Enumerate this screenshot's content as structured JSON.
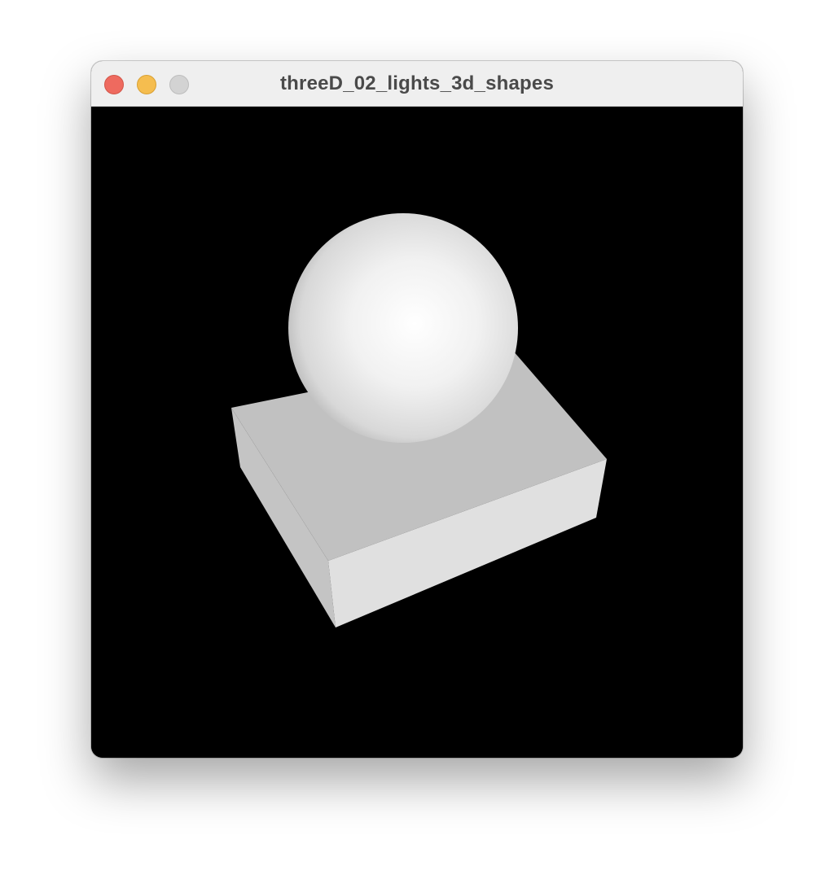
{
  "window": {
    "title": "threeD_02_lights_3d_shapes"
  },
  "scene": {
    "background_color": "#000000",
    "objects": [
      "sphere",
      "box"
    ]
  }
}
